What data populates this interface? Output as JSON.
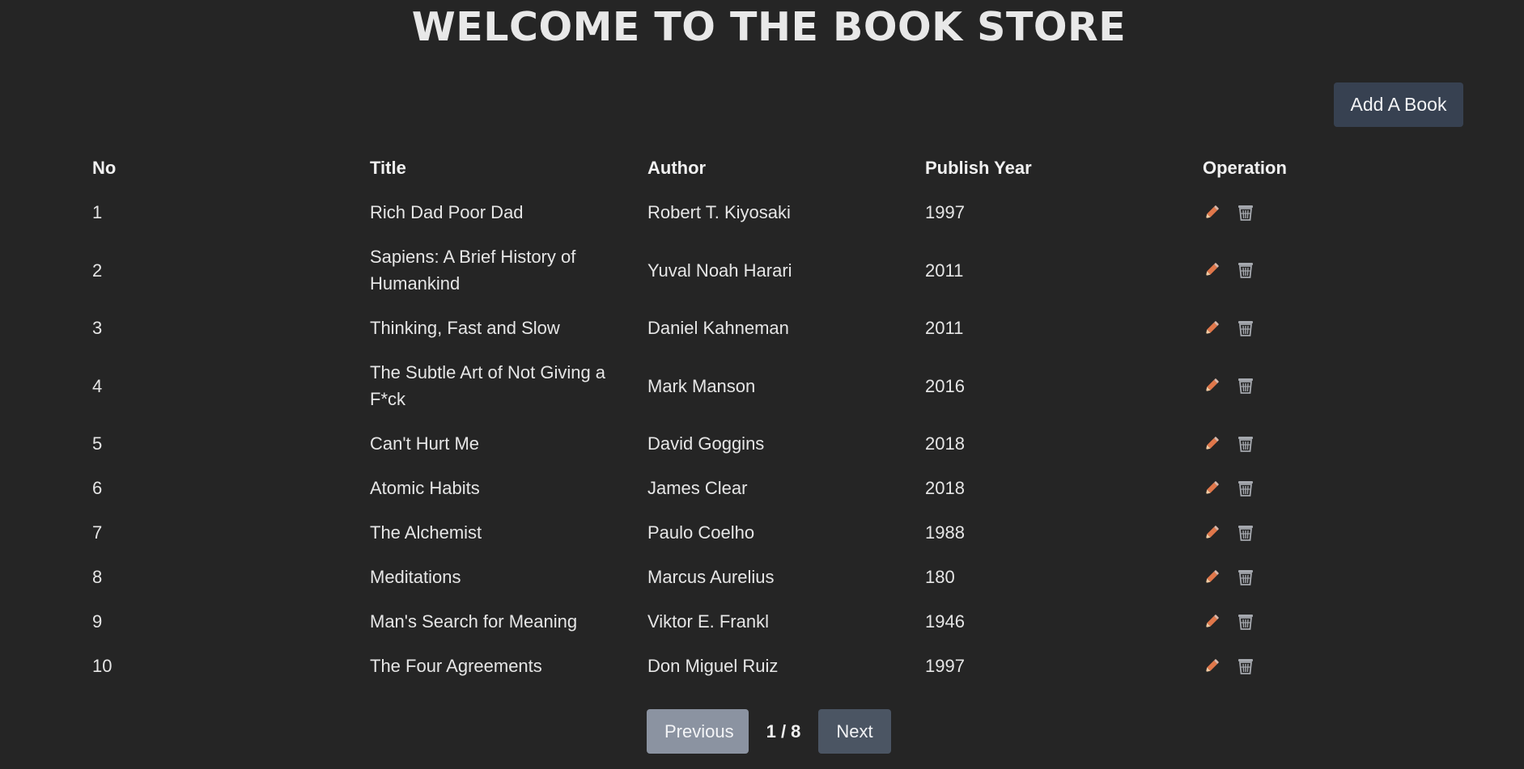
{
  "header": {
    "title": "WELCOME TO THE BOOK STORE"
  },
  "toolbar": {
    "add_label": "Add A Book"
  },
  "table": {
    "columns": [
      "No",
      "Title",
      "Author",
      "Publish Year",
      "Operation"
    ],
    "rows": [
      {
        "no": "1",
        "title": "Rich Dad Poor Dad",
        "author": "Robert T. Kiyosaki",
        "year": "1997"
      },
      {
        "no": "2",
        "title": "Sapiens: A Brief History of Humankind",
        "author": "Yuval Noah Harari",
        "year": "2011"
      },
      {
        "no": "3",
        "title": "Thinking, Fast and Slow",
        "author": "Daniel Kahneman",
        "year": "2011"
      },
      {
        "no": "4",
        "title": "The Subtle Art of Not Giving a F*ck",
        "author": "Mark Manson",
        "year": "2016"
      },
      {
        "no": "5",
        "title": "Can't Hurt Me",
        "author": "David Goggins",
        "year": "2018"
      },
      {
        "no": "6",
        "title": "Atomic Habits",
        "author": "James Clear",
        "year": "2018"
      },
      {
        "no": "7",
        "title": "The Alchemist",
        "author": "Paulo Coelho",
        "year": "1988"
      },
      {
        "no": "8",
        "title": "Meditations",
        "author": "Marcus Aurelius",
        "year": "180"
      },
      {
        "no": "9",
        "title": "Man's Search for Meaning",
        "author": "Viktor E. Frankl",
        "year": "1946"
      },
      {
        "no": "10",
        "title": "The Four Agreements",
        "author": "Don Miguel Ruiz",
        "year": "1997"
      }
    ],
    "operation_icons": [
      "pencil-icon",
      "wastebasket-icon"
    ]
  },
  "pagination": {
    "previous_label": "Previous",
    "page_indicator": "1 / 8",
    "next_label": "Next"
  },
  "colors": {
    "background": "#252525",
    "button": "#374151",
    "previous_disabled": "#8b93a1",
    "next": "#4b5563",
    "pencil": "#e0774a",
    "trash": "#a5a8ae"
  }
}
